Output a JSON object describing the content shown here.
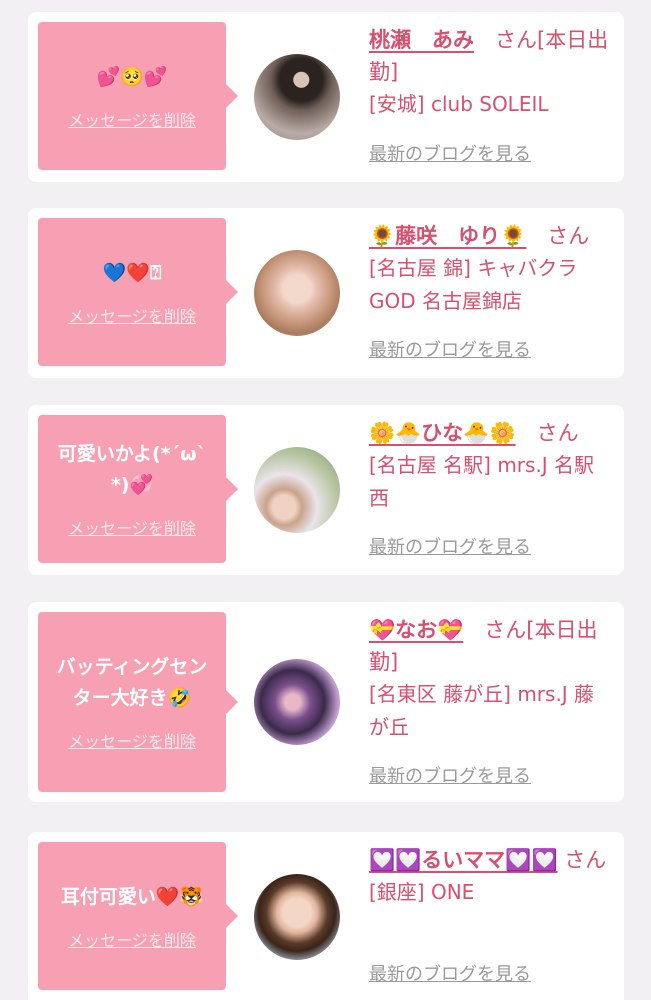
{
  "items": [
    {
      "message": "💕🥺💕",
      "delete_label": "メッセージを削除",
      "name": "桃瀬　あみ",
      "san": "　さん[本日出勤]",
      "shop": "[安城] club SOLEIL",
      "blog_label": "最新のブログを見る"
    },
    {
      "message": "💙❤️⍰",
      "delete_label": "メッセージを削除",
      "name": "🌻藤咲　ゆり🌻",
      "san": "　さん",
      "shop": "[名古屋 錦] キャバクラ GOD 名古屋錦店",
      "blog_label": "最新のブログを見る"
    },
    {
      "message": "可愛いかよ(*´ω`*)💞",
      "delete_label": "メッセージを削除",
      "name": "🌼🐣ひな🐣🌼",
      "san": "　さん",
      "shop": "[名古屋 名駅] mrs.J 名駅西",
      "blog_label": "最新のブログを見る"
    },
    {
      "message": "バッティングセンター大好き🤣",
      "delete_label": "メッセージを削除",
      "name": "💝なお💝",
      "san": "　さん[本日出勤]",
      "shop": "[名東区 藤が丘] mrs.J 藤が丘",
      "blog_label": "最新のブログを見る"
    },
    {
      "message": "耳付可愛い❤️🐯",
      "delete_label": "メッセージを削除",
      "name": "💟💟るいママ💟💟",
      "san": "さん",
      "shop": "[銀座] ONE",
      "blog_label": "最新のブログを見る"
    }
  ]
}
